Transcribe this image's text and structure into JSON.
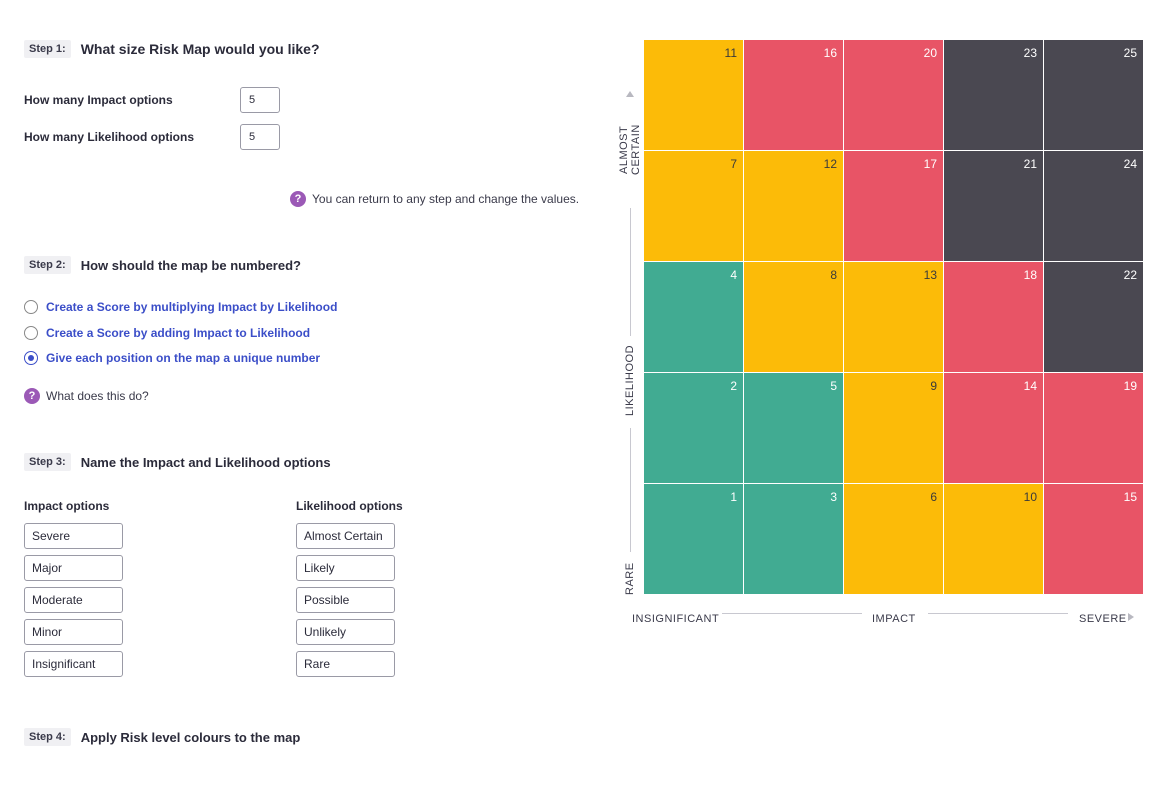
{
  "step1": {
    "badge": "Step 1:",
    "title": "What size Risk Map would you like?",
    "impact_label": "How many Impact options",
    "impact_value": "5",
    "likelihood_label": "How many Likelihood options",
    "likelihood_value": "5",
    "help_text": "You can return to any step and change the values."
  },
  "step2": {
    "badge": "Step 2:",
    "title": "How should the map be numbered?",
    "options": [
      {
        "label": "Create a Score by multiplying Impact by Likelihood",
        "checked": false
      },
      {
        "label": "Create a Score by adding Impact to Likelihood",
        "checked": false
      },
      {
        "label": "Give each position on the map a unique number",
        "checked": true
      }
    ],
    "help_text": "What does this do?"
  },
  "step3": {
    "badge": "Step 3:",
    "title": "Name the Impact and Likelihood options",
    "impact_heading": "Impact options",
    "impact_options": [
      "Severe",
      "Major",
      "Moderate",
      "Minor",
      "Insignificant"
    ],
    "likelihood_heading": "Likelihood options",
    "likelihood_options": [
      "Almost Certain",
      "Likely",
      "Possible",
      "Unlikely",
      "Rare"
    ]
  },
  "step4": {
    "badge": "Step 4:",
    "title": "Apply Risk level colours to the map"
  },
  "help_glyph": "?",
  "colors": {
    "yellow": "#fcbb08",
    "red": "#e85466",
    "dark": "#4a4851",
    "green": "#41ab92",
    "accent": "#3b4ec8",
    "help": "#9b59b6"
  },
  "map": {
    "rows": [
      [
        {
          "n": "11",
          "c": "yellow"
        },
        {
          "n": "16",
          "c": "red"
        },
        {
          "n": "20",
          "c": "red"
        },
        {
          "n": "23",
          "c": "dark"
        },
        {
          "n": "25",
          "c": "dark"
        }
      ],
      [
        {
          "n": "7",
          "c": "yellow"
        },
        {
          "n": "12",
          "c": "yellow"
        },
        {
          "n": "17",
          "c": "red"
        },
        {
          "n": "21",
          "c": "dark"
        },
        {
          "n": "24",
          "c": "dark"
        }
      ],
      [
        {
          "n": "4",
          "c": "green"
        },
        {
          "n": "8",
          "c": "yellow"
        },
        {
          "n": "13",
          "c": "yellow"
        },
        {
          "n": "18",
          "c": "red"
        },
        {
          "n": "22",
          "c": "dark"
        }
      ],
      [
        {
          "n": "2",
          "c": "green"
        },
        {
          "n": "5",
          "c": "green"
        },
        {
          "n": "9",
          "c": "yellow"
        },
        {
          "n": "14",
          "c": "red"
        },
        {
          "n": "19",
          "c": "red"
        }
      ],
      [
        {
          "n": "1",
          "c": "green"
        },
        {
          "n": "3",
          "c": "green"
        },
        {
          "n": "6",
          "c": "yellow"
        },
        {
          "n": "10",
          "c": "yellow"
        },
        {
          "n": "15",
          "c": "red"
        }
      ]
    ],
    "y_axis": {
      "top": "ALMOST CERTAIN",
      "middle": "LIKELIHOOD",
      "bottom": "RARE"
    },
    "x_axis": {
      "left": "INSIGNIFICANT",
      "middle": "IMPACT",
      "right": "SEVERE"
    }
  }
}
